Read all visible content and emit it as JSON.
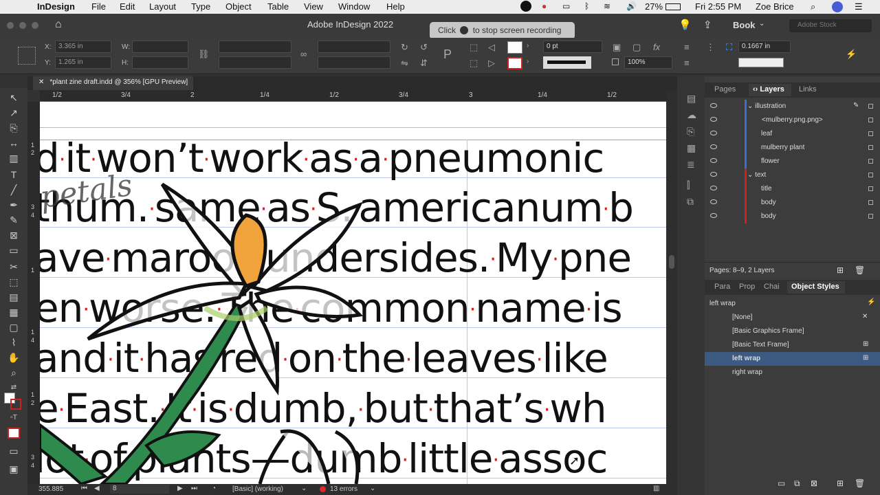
{
  "menubar": {
    "app": "InDesign",
    "items": [
      "File",
      "Edit",
      "Layout",
      "Type",
      "Object",
      "Table",
      "View",
      "Window",
      "Help"
    ],
    "battery": "27%",
    "clock": "Fri 2:55 PM",
    "user": "Zoe Brice"
  },
  "titlebar": {
    "title": "Adobe InDesign 2022",
    "recording_tooltip_pre": "Click",
    "recording_tooltip_post": "to stop screen recording",
    "workspace": "Book",
    "stock_placeholder": "Adobe Stock"
  },
  "control": {
    "x_label": "X:",
    "x_value": "3.365 in",
    "y_label": "Y:",
    "y_value": "1.265 in",
    "w_label": "W:",
    "h_label": "H:",
    "stroke_weight": "0 pt",
    "zoom_percent": "100%",
    "offset_value": "0.1667 in"
  },
  "document": {
    "tab_label": "*plant zine draft.indd @ 356% [GPU Preview]",
    "hruler_ticks": [
      "1/2",
      "3/4",
      "2",
      "1/4",
      "1/2",
      "3/4",
      "3",
      "1/4",
      "1/2"
    ],
    "vruler_ticks": [
      "1",
      "2",
      "3",
      "4",
      "1",
      "1",
      "4",
      "1",
      "2",
      "3",
      "4"
    ],
    "lines": [
      "d·it·won’t·work·as·a·pneumonic",
      "thum.·same·as·S.·americanum·b",
      "ave·maroon·undersides.·My·pne",
      "en·worse.·The·common·name·is",
      "and·it·has·red·on·the·leaves·like",
      "e·East.·It·is·dumb,·but·that’s·wh",
      "lot·of·plants—dumb·little·assoc"
    ],
    "sketch_word": "petals"
  },
  "status": {
    "position": "355.885",
    "page": "8",
    "style": "[Basic] (working)",
    "errors": "13 errors"
  },
  "panel": {
    "tabs": [
      "Pages",
      "Layers",
      "Links"
    ],
    "active_tab": "Layers",
    "layers": [
      {
        "label": "illustration",
        "level": 0,
        "color": "#3a6fd8"
      },
      {
        "label": "<mulberry.png.png>",
        "level": 1,
        "color": "#3a6fd8"
      },
      {
        "label": "leaf",
        "level": 1,
        "color": "#3a6fd8"
      },
      {
        "label": "mulberry plant",
        "level": 1,
        "color": "#3a6fd8"
      },
      {
        "label": "flower",
        "level": 1,
        "color": "#3a6fd8"
      },
      {
        "label": "text",
        "level": 0,
        "color": "#d21f1f"
      },
      {
        "label": "title",
        "level": 1,
        "color": "#d21f1f"
      },
      {
        "label": "body",
        "level": 1,
        "color": "#d21f1f"
      },
      {
        "label": "body",
        "level": 1,
        "color": "#d21f1f"
      }
    ],
    "pages_info": "Pages: 8–9, 2 Layers",
    "lower_tabs": [
      "Para",
      "Prop",
      "Chai",
      "Object Styles"
    ],
    "lower_active": "Object Styles",
    "current_style": "left wrap",
    "styles": [
      "[None]",
      "[Basic Graphics Frame]",
      "[Basic Text Frame]",
      "left wrap",
      "right wrap"
    ],
    "selected_style": "left wrap"
  },
  "colors": {
    "illustration_layer": "#3a6fd8",
    "text_layer": "#d21f1f",
    "selection": "#3d5a83",
    "dot": "#d21f1f"
  }
}
